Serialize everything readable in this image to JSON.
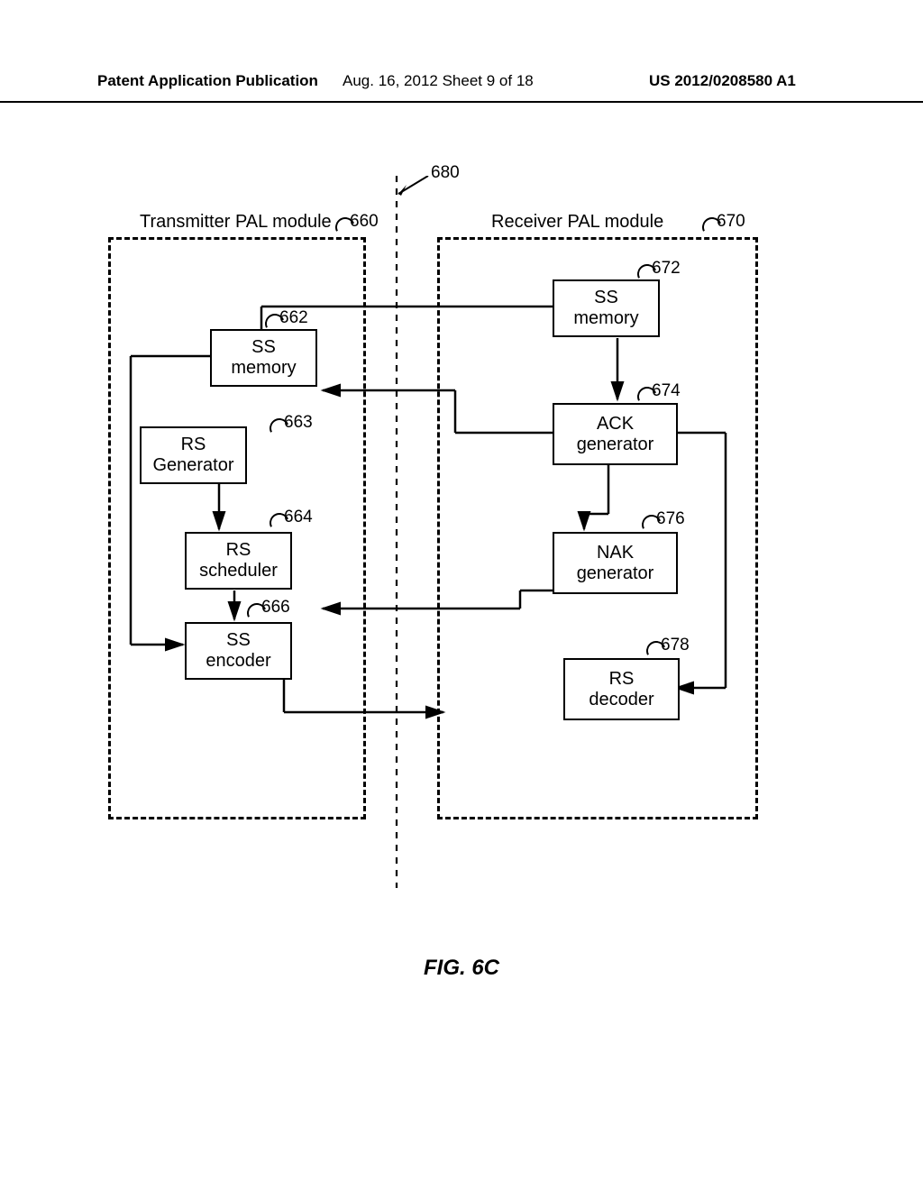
{
  "header": {
    "left": "Patent Application Publication",
    "center": "Aug. 16, 2012  Sheet 9 of 18",
    "right": "US 2012/0208580 A1"
  },
  "figure_label": "FIG. 6C",
  "transmitter": {
    "title": "Transmitter PAL module",
    "ref": "660",
    "blocks": {
      "ss_memory": {
        "label1": "SS",
        "label2": "memory",
        "ref": "662"
      },
      "rs_generator": {
        "label1": "RS",
        "label2": "Generator",
        "ref": "663"
      },
      "rs_scheduler": {
        "label1": "RS",
        "label2": "scheduler",
        "ref": "664"
      },
      "ss_encoder": {
        "label1": "SS",
        "label2": "encoder",
        "ref": "666"
      }
    }
  },
  "receiver": {
    "title": "Receiver PAL module",
    "ref": "670",
    "blocks": {
      "ss_memory": {
        "label1": "SS",
        "label2": "memory",
        "ref": "672"
      },
      "ack_generator": {
        "label1": "ACK",
        "label2": "generator",
        "ref": "674"
      },
      "nak_generator": {
        "label1": "NAK",
        "label2": "generator",
        "ref": "676"
      },
      "rs_decoder": {
        "label1": "RS",
        "label2": "decoder",
        "ref": "678"
      }
    }
  },
  "center_divider_ref": "680"
}
